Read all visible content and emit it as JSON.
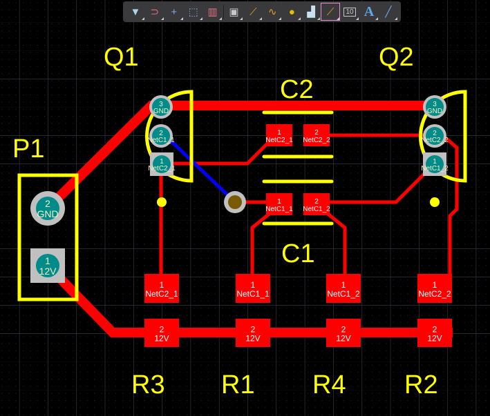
{
  "toolbar": {
    "items": [
      {
        "name": "filter",
        "glyph": "▼",
        "color": "#a8d8e8"
      },
      {
        "name": "interactive-routing",
        "glyph": "⊃",
        "color": "#e07080"
      },
      {
        "name": "crosshair",
        "glyph": "+",
        "color": "#7fa8e8"
      },
      {
        "name": "select-rectangle",
        "glyph": "⬚",
        "color": "#7fa8e8"
      },
      {
        "name": "align",
        "glyph": "▥",
        "color": "#e07080"
      },
      {
        "name": "component",
        "glyph": "▣",
        "color": "#c8c8c8"
      },
      {
        "name": "route",
        "glyph": "⟋",
        "color": "#e0a020"
      },
      {
        "name": "tune-length",
        "glyph": "∿",
        "color": "#e0a020"
      },
      {
        "name": "via",
        "glyph": "●",
        "color": "#e0c000"
      },
      {
        "name": "polygon",
        "glyph": "▟",
        "color": "#c8e0f0"
      },
      {
        "name": "place-track",
        "glyph": "⟋",
        "color": "#e0a020"
      },
      {
        "name": "dimension",
        "glyph": "10",
        "color": "#c8c8c8"
      },
      {
        "name": "text",
        "glyph": "A",
        "color": "#5fa8e8"
      },
      {
        "name": "line",
        "glyph": "╱",
        "color": "#5fa8e8"
      }
    ]
  },
  "colors": {
    "background": "#000000",
    "silkscreen": "#ffff00",
    "top_layer": "#ff0000",
    "bottom_layer": "#0000ff",
    "pad_hole": "#008b8b",
    "pad_ring": "#c0c0c0",
    "grid": "#3c3c48"
  },
  "designators": {
    "Q1": "Q1",
    "Q2": "Q2",
    "P1": "P1",
    "C1": "C1",
    "C2": "C2",
    "R1": "R1",
    "R2": "R2",
    "R3": "R3",
    "R4": "R4"
  },
  "pads": {
    "q1_3": {
      "num": "3",
      "net": "GND"
    },
    "q1_2": {
      "num": "2",
      "net": "NetC1_1"
    },
    "q1_1": {
      "num": "1",
      "net": "NetC2_1"
    },
    "q2_3": {
      "num": "3",
      "net": "GND"
    },
    "q2_2": {
      "num": "2",
      "net": "NetC2_2"
    },
    "q2_1": {
      "num": "1",
      "net": "NetC1_2"
    },
    "p1_2": {
      "num": "2",
      "net": "GND"
    },
    "p1_1": {
      "num": "1",
      "net": "12V"
    },
    "c2_1": {
      "num": "1",
      "net": "NetC2_1"
    },
    "c2_2": {
      "num": "2",
      "net": "NetC2_2"
    },
    "c1_1": {
      "num": "1",
      "net": "NetC1_1"
    },
    "c1_2": {
      "num": "2",
      "net": "NetC1_2"
    },
    "r3_1": {
      "num": "1",
      "net": "NetC2_1"
    },
    "r1_1": {
      "num": "1",
      "net": "NetC1_1"
    },
    "r4_1": {
      "num": "1",
      "net": "NetC1_2"
    },
    "r2_1": {
      "num": "1",
      "net": "NetC2_2"
    },
    "r3_2": {
      "num": "2",
      "net": "12V"
    },
    "r1_2": {
      "num": "2",
      "net": "12V"
    },
    "r4_2": {
      "num": "2",
      "net": "12V"
    },
    "r2_2": {
      "num": "2",
      "net": "12V"
    }
  }
}
